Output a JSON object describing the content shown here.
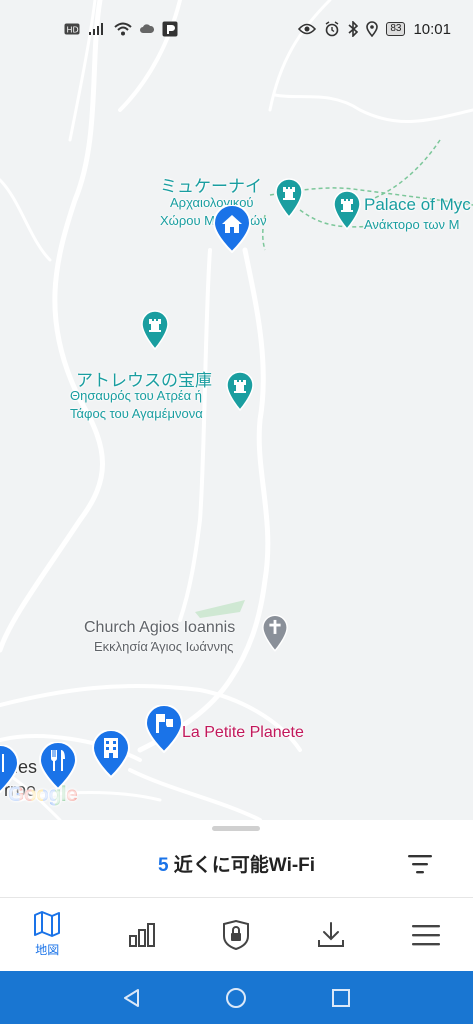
{
  "status_bar": {
    "time": "10:01",
    "battery": "83",
    "left_icons": [
      "hd-icon",
      "signal-icon",
      "wifi-icon",
      "cloud-icon",
      "app-icon"
    ],
    "right_icons": [
      "eye-icon",
      "alarm-icon",
      "bluetooth-icon",
      "location-icon"
    ]
  },
  "map": {
    "labels": {
      "mycenae_ja": "ミュケーナイ",
      "archaeological_1": "Αρχαιολογικού",
      "archaeological_2": "Χώρου Μ",
      "archaeological_3": "ών",
      "palace_en": "Palace of Myc",
      "palace_gr": "Ανάκτορο των Μ",
      "atreus_ja": "アトレウスの宝庫",
      "atreus_gr_1": "Θησαυρός του Ατρέα ή",
      "atreus_gr_2": "Τάφος του Αγαμέμνονα",
      "church_en": "Church Agios Ioannis",
      "church_gr": "Εκκλησία Άγιος Ιωάννης",
      "la_petite": "La Petite Planete",
      "partial_1": "nes",
      "partial_2": "rroe"
    },
    "google_logo": "Google",
    "colors": {
      "teal": "#1a9ea0",
      "blue_pin": "#1a73e8",
      "pink": "#c2185b",
      "road": "#ffffff",
      "background": "#f1f3f4"
    }
  },
  "sheet": {
    "count": "5",
    "title": "近くに可能Wi-Fi"
  },
  "nav": {
    "items": [
      {
        "label": "地図",
        "icon": "map-icon"
      },
      {
        "label": "",
        "icon": "stats-icon"
      },
      {
        "label": "",
        "icon": "lock-shield-icon"
      },
      {
        "label": "",
        "icon": "download-icon"
      },
      {
        "label": "",
        "icon": "menu-icon"
      }
    ]
  },
  "system_nav": [
    "back-icon",
    "home-icon",
    "recents-icon"
  ]
}
